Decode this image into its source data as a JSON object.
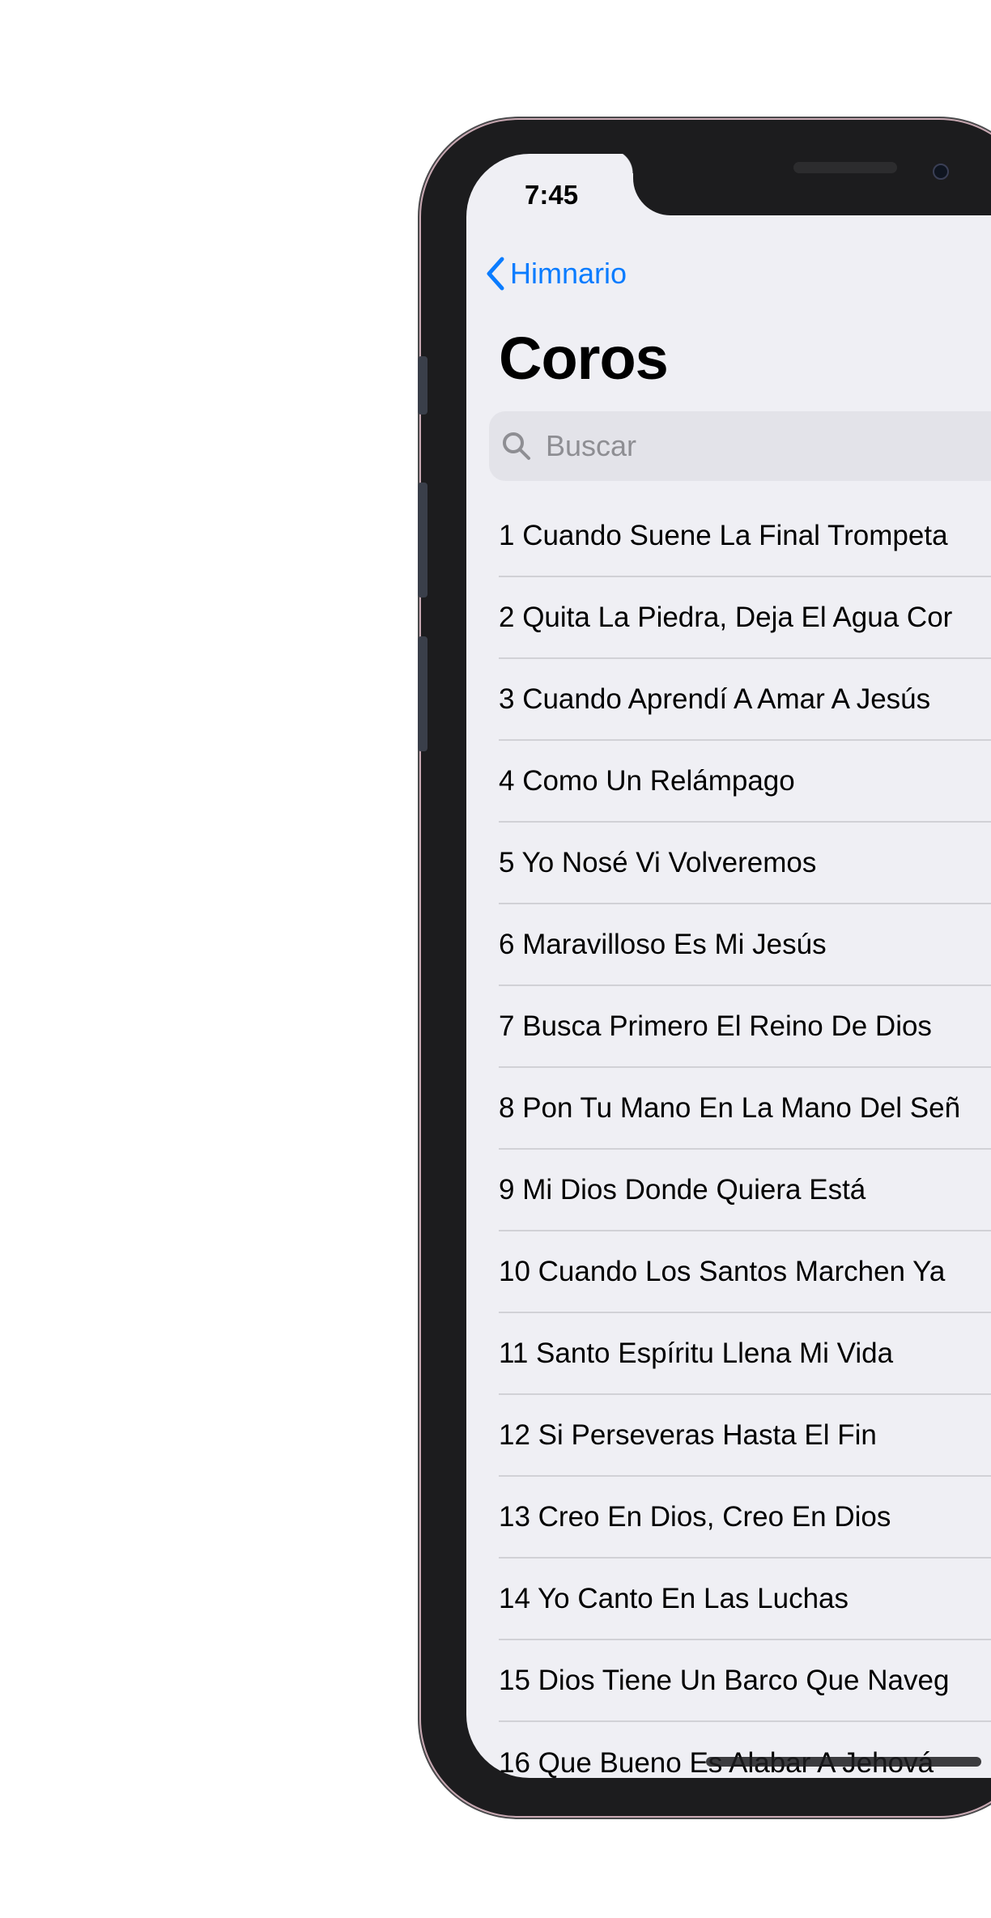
{
  "status_bar": {
    "time": "7:45"
  },
  "nav": {
    "back_label": "Himnario",
    "title": "Coros"
  },
  "search": {
    "placeholder": "Buscar"
  },
  "songs": [
    "1 Cuando Suene La Final Trompeta",
    "2 Quita La Piedra, Deja El Agua Cor",
    "3 Cuando Aprendí A Amar A Jesús",
    "4 Como Un Relámpago",
    "5 Yo Nosé Vi Volveremos",
    "6 Maravilloso Es Mi Jesús",
    "7 Busca Primero El Reino De Dios",
    "8 Pon Tu Mano En La Mano Del Señ",
    "9 Mi Dios Donde Quiera Está",
    "10 Cuando Los Santos Marchen Ya",
    "11 Santo Espíritu Llena Mi Vida",
    "12 Si Perseveras Hasta El Fin",
    "13 Creo En Dios, Creo En Dios",
    "14 Yo Canto En Las Luchas",
    "15 Dios Tiene Un Barco Que Naveg",
    "16 Que Bueno Es Alabar A Jehová"
  ],
  "colors": {
    "accent": "#0a7cff",
    "background": "#efeff4",
    "separator": "#d1d1d6"
  }
}
